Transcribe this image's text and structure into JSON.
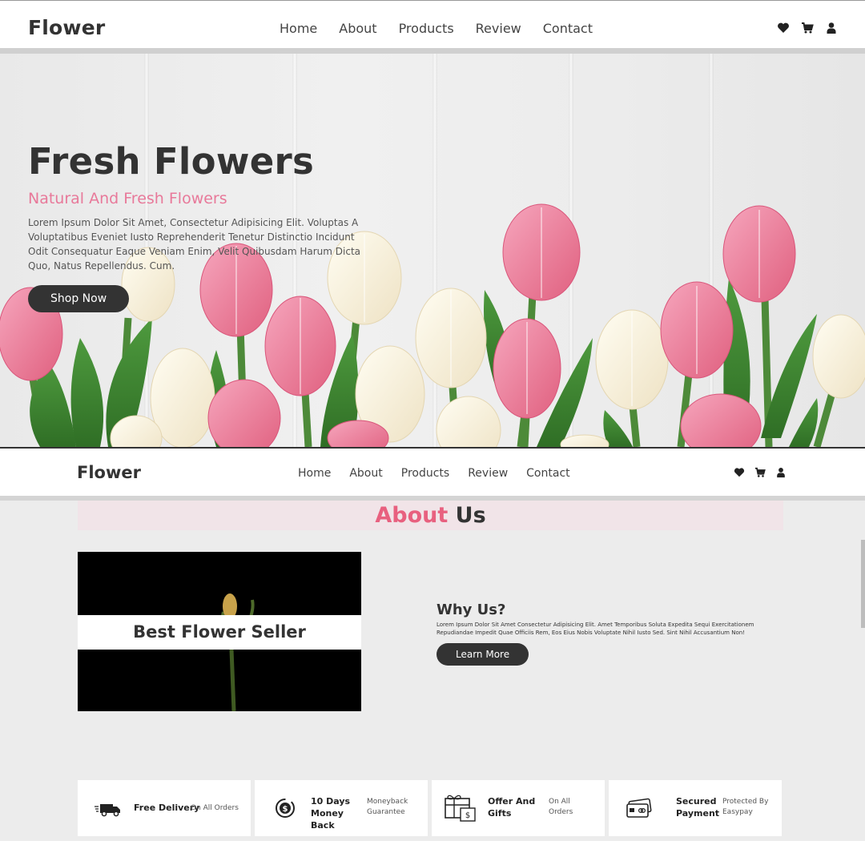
{
  "top": {
    "logo": "Flower",
    "nav": [
      "Home",
      "About",
      "Products",
      "Review",
      "Contact"
    ],
    "icons": [
      "heart-icon",
      "cart-icon",
      "user-icon"
    ]
  },
  "hero": {
    "title": "Fresh Flowers",
    "subtitle": "Natural And Fresh Flowers",
    "description": "Lorem Ipsum Dolor Sit Amet, Consectetur Adipisicing Elit. Voluptas A Voluptatibus Eveniet Iusto Reprehenderit Tenetur Distinctio Incidunt Odit Consequatur Eaque Veniam Enim, Velit Quibusdam Harum Dicta Quo, Natus Repellendus. Cum.",
    "button": "Shop Now"
  },
  "bottom": {
    "logo": "Flower",
    "nav": [
      "Home",
      "About",
      "Products",
      "Review",
      "Contact"
    ],
    "icons": [
      "heart-icon",
      "cart-icon",
      "user-icon"
    ]
  },
  "about": {
    "heading_pink": "About",
    "heading_dark": "Us",
    "video_caption": "Best Flower Seller",
    "why_title": "Why Us?",
    "why_desc": "Lorem Ipsum Dolor Sit Amet Consectetur Adipisicing Elit. Amet Temporibus Soluta Expedita Sequi Exercitationem Repudiandae Impedit Quae Officiis Rem, Eos Eius Nobis Voluptate Nihil Iusto Sed. Sint Nihil Accusantium Non!",
    "button": "Learn More"
  },
  "features": [
    {
      "icon": "delivery-truck-icon",
      "title": "Free Delivery",
      "sub": "On All Orders"
    },
    {
      "icon": "money-back-icon",
      "title": "10 Days Money Back",
      "sub": "Moneyback Guarantee"
    },
    {
      "icon": "gift-icon",
      "title": "Offer And Gifts",
      "sub": "On All Orders"
    },
    {
      "icon": "payment-card-icon",
      "title": "Secured Payment",
      "sub": "Protected By Easypay"
    }
  ],
  "colors": {
    "accent": "#e8607f",
    "dark": "#333333",
    "background": "#ececec"
  }
}
